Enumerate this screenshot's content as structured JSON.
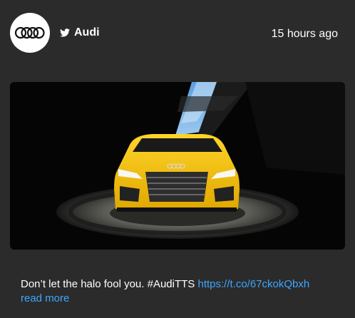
{
  "post": {
    "account_name": "Audi",
    "timestamp": "15 hours ago",
    "avatar_icon": "audi-rings-logo",
    "network_icon": "twitter-bird-icon",
    "media_icon": "yellow-sports-car-photo",
    "text": "Don’t let the halo fool you. #AudiTTS",
    "link_text": "https://t.co/67ckokQbxh",
    "read_more": "read more"
  },
  "colors": {
    "background": "#2b2b2b",
    "link": "#3ea6ff",
    "car": "#f5c518"
  }
}
